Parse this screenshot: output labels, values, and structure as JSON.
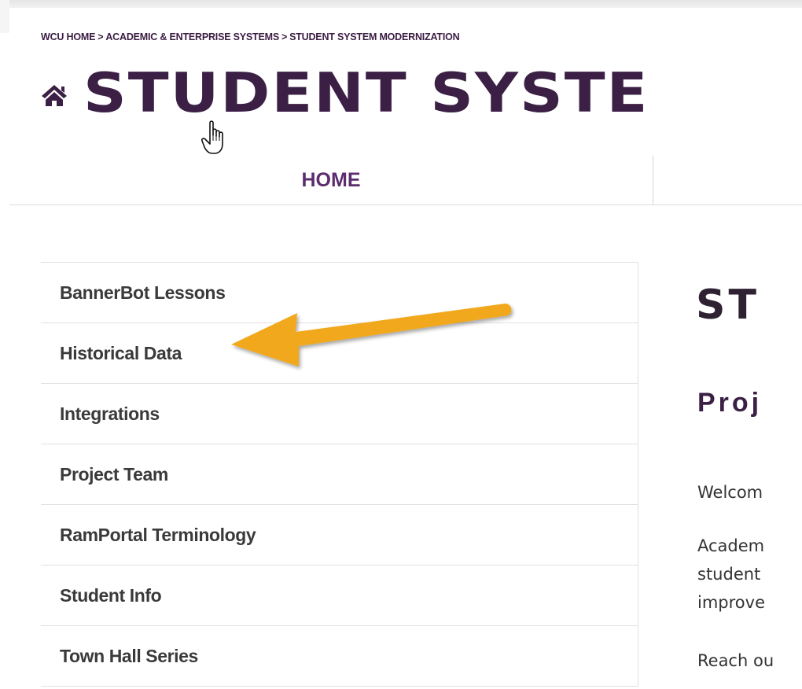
{
  "breadcrumb": {
    "items": [
      "WCU HOME",
      "ACADEMIC & ENTERPRISE SYSTEMS",
      "STUDENT SYSTEM MODERNIZATION"
    ],
    "separator": ">"
  },
  "site": {
    "title": "STUDENT SYSTE",
    "home_icon": "home-icon",
    "title_color": "#3b1f45"
  },
  "nav": {
    "home_label": "HOME",
    "home_color": "#5c2d6e"
  },
  "sidebar": {
    "items": [
      {
        "label": "BannerBot Lessons"
      },
      {
        "label": "Historical Data"
      },
      {
        "label": "Integrations"
      },
      {
        "label": "Project Team"
      },
      {
        "label": "RamPortal Terminology"
      },
      {
        "label": "Student Info"
      },
      {
        "label": "Town Hall Series"
      }
    ]
  },
  "annotation": {
    "arrow_icon": "arrow-icon",
    "arrow_color": "#f2a81d",
    "pointer_icon": "hand-pointer-icon"
  },
  "main": {
    "heading": "ST",
    "subheading": "Proj",
    "paragraphs": {
      "p1": "Welcom",
      "p2_line1": "Academ",
      "p2_line2": "student",
      "p2_line3": "improve",
      "p3": "Reach ou"
    }
  }
}
